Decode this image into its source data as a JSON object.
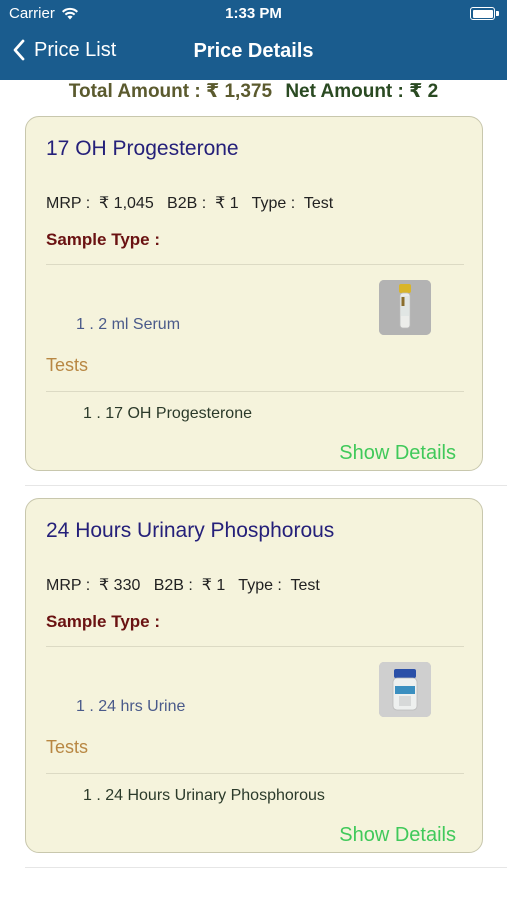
{
  "status_bar": {
    "carrier": "Carrier",
    "time": "1:33 PM"
  },
  "nav": {
    "back_label": "Price List",
    "title": "Price Details"
  },
  "summary": {
    "total_amount": "Total Amount : ₹ 1,375",
    "net_amount": "Net Amount : ₹ 2"
  },
  "tests": [
    {
      "title": "17 OH Progesterone",
      "price_line": "MRP :  ₹ 1,045   B2B :  ₹ 1   Type :  Test",
      "sample_type_label": "Sample Type :",
      "sample_item": "1 . 2 ml Serum",
      "sample_image_icon": "serum-tube-icon",
      "tests_label": "Tests",
      "test_item": "1 . 17 OH Progesterone",
      "show_details": "Show Details"
    },
    {
      "title": "24 Hours Urinary Phosphorous",
      "price_line": "MRP :  ₹ 330   B2B :  ₹ 1   Type :  Test",
      "sample_type_label": "Sample Type :",
      "sample_item": "1 . 24 hrs Urine",
      "sample_image_icon": "urine-container-icon",
      "tests_label": "Tests",
      "test_item": "1 . 24 Hours Urinary Phosphorous",
      "show_details": "Show Details"
    }
  ],
  "colors": {
    "header_bg": "#1a5c8e",
    "card_bg": "#f5f3dc",
    "title": "#25207a",
    "sample_head": "#6a1212",
    "tests_head": "#b88743",
    "show_details": "#40c95a"
  }
}
